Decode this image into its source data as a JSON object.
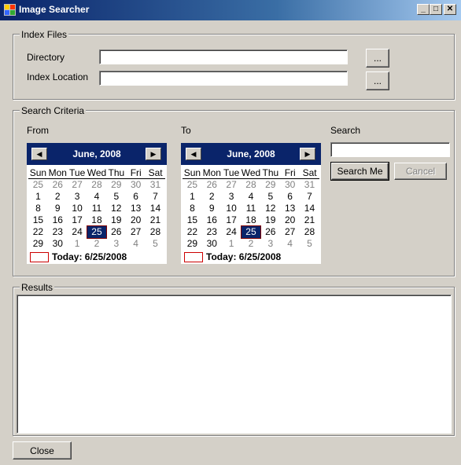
{
  "window": {
    "title": "Image Searcher",
    "min": "_",
    "max": "□",
    "close": "✕"
  },
  "index_files": {
    "legend": "Index Files",
    "directory_label": "Directory",
    "directory_value": "",
    "location_label": "Index Location",
    "location_value": "",
    "browse_label": "..."
  },
  "search_criteria": {
    "legend": "Search Criteria",
    "from_label": "From",
    "to_label": "To",
    "search_label": "Search",
    "search_value": "",
    "search_button": "Search Me",
    "cancel_button": "Cancel"
  },
  "calendar": {
    "month": "June, 2008",
    "prev": "◀",
    "next": "▶",
    "dow": [
      "Sun",
      "Mon",
      "Tue",
      "Wed",
      "Thu",
      "Fri",
      "Sat"
    ],
    "days": [
      "25",
      "26",
      "27",
      "28",
      "29",
      "30",
      "31",
      "1",
      "2",
      "3",
      "4",
      "5",
      "6",
      "7",
      "8",
      "9",
      "10",
      "11",
      "12",
      "13",
      "14",
      "15",
      "16",
      "17",
      "18",
      "19",
      "20",
      "21",
      "22",
      "23",
      "24",
      "25",
      "26",
      "27",
      "28",
      "29",
      "30",
      "1",
      "2",
      "3",
      "4",
      "5"
    ],
    "dim_indices": [
      0,
      1,
      2,
      3,
      4,
      5,
      6,
      37,
      38,
      39,
      40,
      41
    ],
    "selected_index": 31,
    "today": "Today: 6/25/2008"
  },
  "results": {
    "legend": "Results"
  },
  "footer": {
    "close_button": "Close"
  }
}
